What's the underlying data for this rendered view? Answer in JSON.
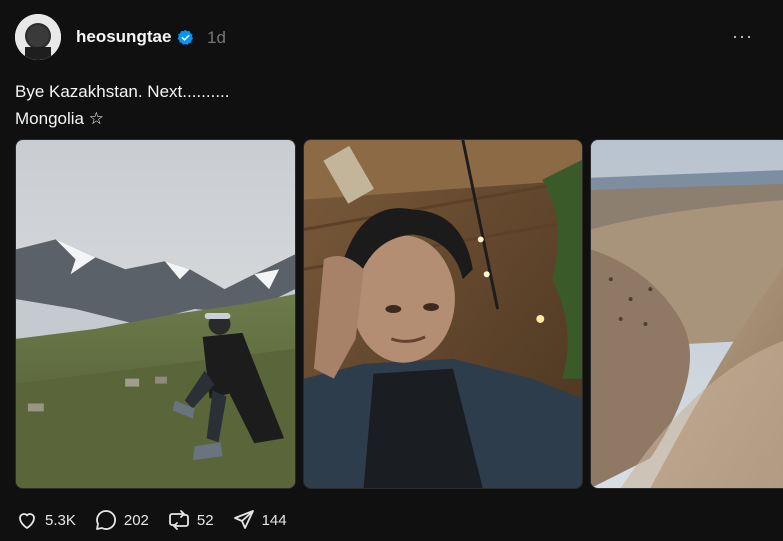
{
  "post": {
    "username": "heosungtae",
    "time": "1d",
    "more_label": "···",
    "text": "Bye Kazakhstan. Next..........\nMongolia ☆"
  },
  "images": [
    {
      "name": "mountain-photo",
      "icon": "photo"
    },
    {
      "name": "selfie-photo",
      "icon": "photo"
    },
    {
      "name": "desert-photo",
      "icon": "photo"
    }
  ],
  "actions": {
    "likes": "5.3K",
    "replies": "202",
    "reposts": "52",
    "shares": "144"
  },
  "colors": {
    "background": "#101010",
    "text": "#f3f5f7",
    "muted": "#777777",
    "verified": "#0095f6"
  }
}
